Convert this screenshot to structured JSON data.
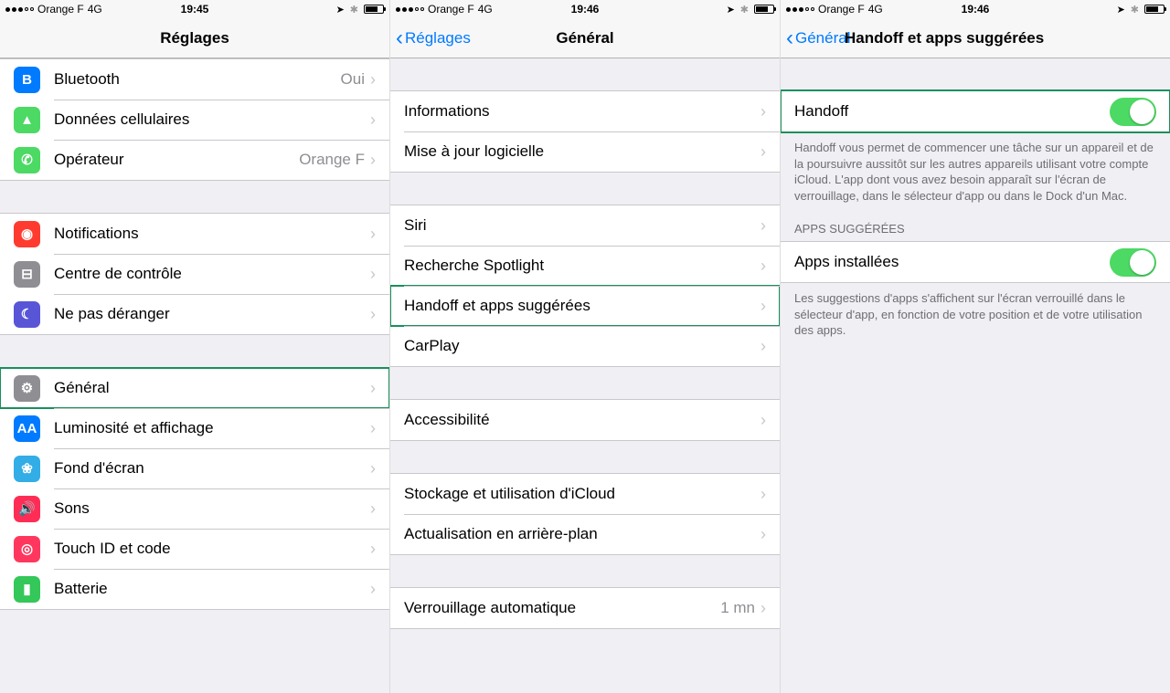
{
  "status": {
    "carrier": "Orange F",
    "network": "4G"
  },
  "screen1": {
    "time": "19:45",
    "title": "Réglages",
    "g1": [
      {
        "label": "Bluetooth",
        "value": "Oui",
        "icon": "bluetooth-icon",
        "bg": "ic-blue"
      },
      {
        "label": "Données cellulaires",
        "value": "",
        "icon": "cellular-icon",
        "bg": "ic-green"
      },
      {
        "label": "Opérateur",
        "value": "Orange F",
        "icon": "phone-icon",
        "bg": "ic-green"
      }
    ],
    "g2": [
      {
        "label": "Notifications",
        "icon": "notifications-icon",
        "bg": "ic-red"
      },
      {
        "label": "Centre de contrôle",
        "icon": "control-center-icon",
        "bg": "ic-gray"
      },
      {
        "label": "Ne pas déranger",
        "icon": "dnd-icon",
        "bg": "ic-purple"
      }
    ],
    "g3": [
      {
        "label": "Général",
        "icon": "gear-icon",
        "bg": "ic-gray",
        "hl": true
      },
      {
        "label": "Luminosité et affichage",
        "icon": "display-icon",
        "bg": "ic-blue"
      },
      {
        "label": "Fond d'écran",
        "icon": "wallpaper-icon",
        "bg": "ic-cyan"
      },
      {
        "label": "Sons",
        "icon": "sounds-icon",
        "bg": "ic-pink"
      },
      {
        "label": "Touch ID et code",
        "icon": "touchid-icon",
        "bg": "ic-rose"
      },
      {
        "label": "Batterie",
        "icon": "battery-icon",
        "bg": "ic-green2"
      }
    ]
  },
  "screen2": {
    "time": "19:46",
    "back": "Réglages",
    "title": "Général",
    "g1": [
      {
        "label": "Informations"
      },
      {
        "label": "Mise à jour logicielle"
      }
    ],
    "g2": [
      {
        "label": "Siri"
      },
      {
        "label": "Recherche Spotlight"
      },
      {
        "label": "Handoff et apps suggérées",
        "hl": true
      },
      {
        "label": "CarPlay"
      }
    ],
    "g3": [
      {
        "label": "Accessibilité"
      }
    ],
    "g4": [
      {
        "label": "Stockage et utilisation d'iCloud"
      },
      {
        "label": "Actualisation en arrière-plan"
      }
    ],
    "g5": [
      {
        "label": "Verrouillage automatique",
        "value": "1 mn"
      }
    ]
  },
  "screen3": {
    "time": "19:46",
    "back": "Général",
    "title": "Handoff et apps suggérées",
    "row_handoff": "Handoff",
    "footer_handoff": "Handoff vous permet de commencer une tâche sur un appareil et de la poursuivre aussitôt sur les autres appareils utilisant votre compte iCloud. L'app dont vous avez besoin apparaît sur l'écran de verrouillage, dans le sélecteur d'app ou dans le Dock d'un Mac.",
    "header_apps": "APPS SUGGÉRÉES",
    "row_apps": "Apps installées",
    "footer_apps": "Les suggestions d'apps s'affichent sur l'écran verrouillé dans le sélecteur d'app, en fonction de votre position et de votre utilisation des apps."
  }
}
